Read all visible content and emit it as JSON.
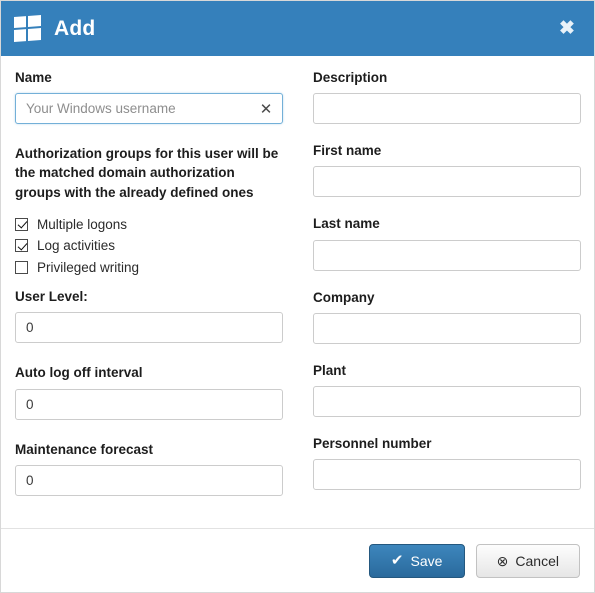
{
  "header": {
    "title": "Add",
    "logo_icon": "windows-logo-icon",
    "close_icon": "close-icon",
    "close_label": "✖",
    "background_color": "#3580bb"
  },
  "left_column": {
    "name_field": {
      "label": "Name",
      "value": "",
      "placeholder": "Your Windows username",
      "clear_icon": "clear-icon",
      "clear_label": "✕"
    },
    "note": "Authorization groups for this user will be the matched domain authorization groups with the already defined ones",
    "checkboxes": [
      {
        "label": "Multiple logons",
        "checked": true
      },
      {
        "label": "Log activities",
        "checked": true
      },
      {
        "label": "Privileged writing",
        "checked": false
      }
    ],
    "fields": [
      {
        "label": "User Level:",
        "value": "0",
        "placeholder": ""
      },
      {
        "label": "Auto log off interval",
        "value": "0",
        "placeholder": ""
      },
      {
        "label": "Maintenance forecast",
        "value": "0",
        "placeholder": ""
      }
    ]
  },
  "right_column": {
    "fields": [
      {
        "label": "Description",
        "value": "",
        "placeholder": ""
      },
      {
        "label": "First name",
        "value": "",
        "placeholder": ""
      },
      {
        "label": "Last name",
        "value": "",
        "placeholder": ""
      },
      {
        "label": "Company",
        "value": "",
        "placeholder": ""
      },
      {
        "label": "Plant",
        "value": "",
        "placeholder": ""
      },
      {
        "label": "Personnel number",
        "value": "",
        "placeholder": ""
      }
    ]
  },
  "footer": {
    "save": {
      "label": "Save",
      "icon": "check-icon",
      "glyph": "✔",
      "color": "#2a6a9c"
    },
    "cancel": {
      "label": "Cancel",
      "icon": "circle-x-icon",
      "glyph": "⊗"
    }
  }
}
